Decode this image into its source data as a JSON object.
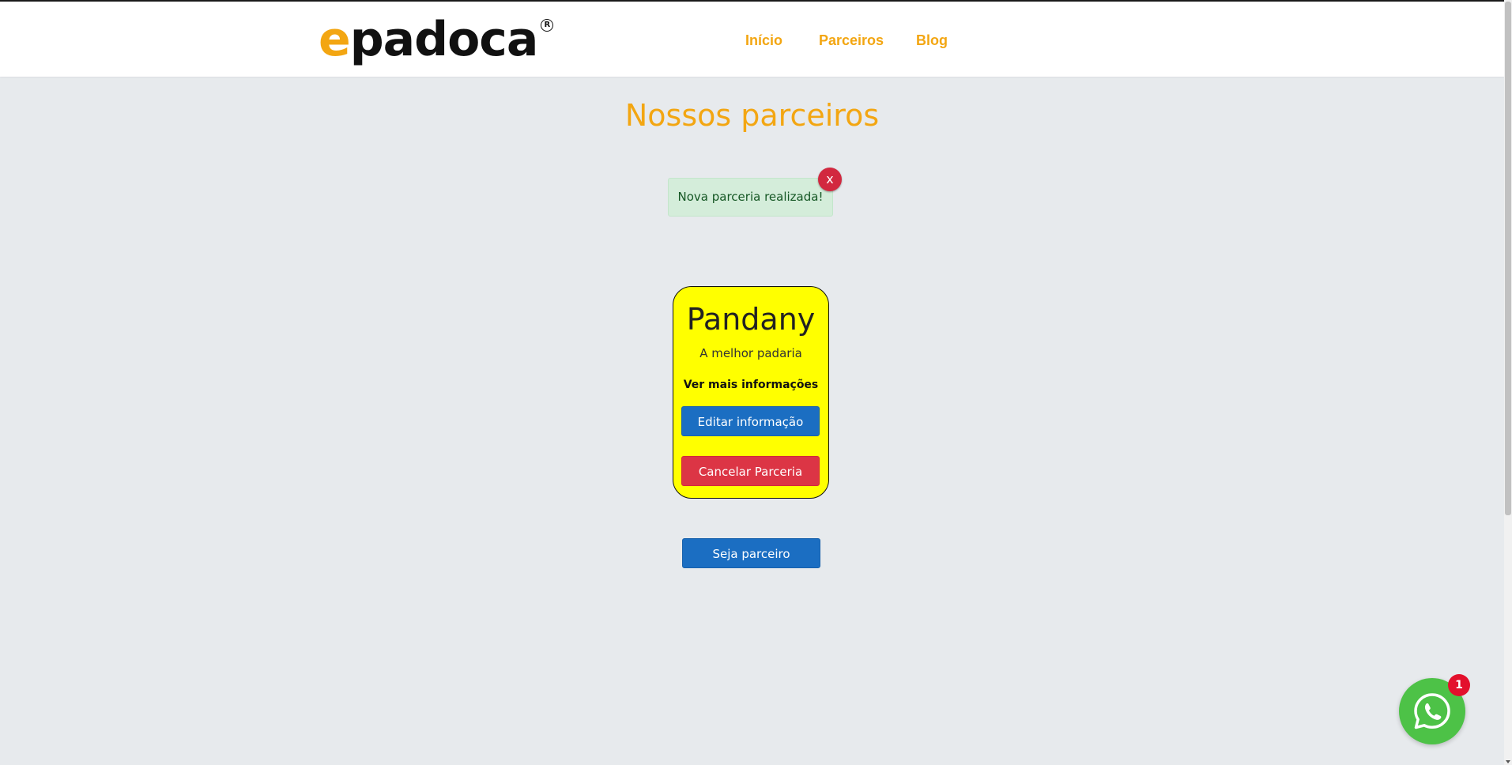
{
  "brand": {
    "logo_first_letter": "e",
    "logo_rest": "padoca",
    "logo_reg_mark": "R",
    "accent_color": "#f3a612"
  },
  "nav": {
    "items": [
      {
        "label": "Início"
      },
      {
        "label": "Parceiros"
      },
      {
        "label": "Blog"
      }
    ]
  },
  "main": {
    "title": "Nossos parceiros",
    "alert": {
      "message": "Nova parceria realizada!",
      "close_label": "x"
    },
    "partner_card": {
      "name": "Pandany",
      "description": "A melhor padaria",
      "more_info_label": "Ver mais informações",
      "edit_button_label": "Editar informação",
      "cancel_button_label": "Cancelar Parceria",
      "card_color": "#ffff00"
    },
    "become_partner_label": "Seja parceiro"
  },
  "whatsapp": {
    "icon": "whatsapp-icon",
    "badge_count": "1"
  },
  "colors": {
    "background": "#e7eaed",
    "primary_button": "#1b6ec2",
    "danger_button": "#dc3545",
    "alert_bg": "#d4edda",
    "whatsapp_green": "#4dc247"
  }
}
